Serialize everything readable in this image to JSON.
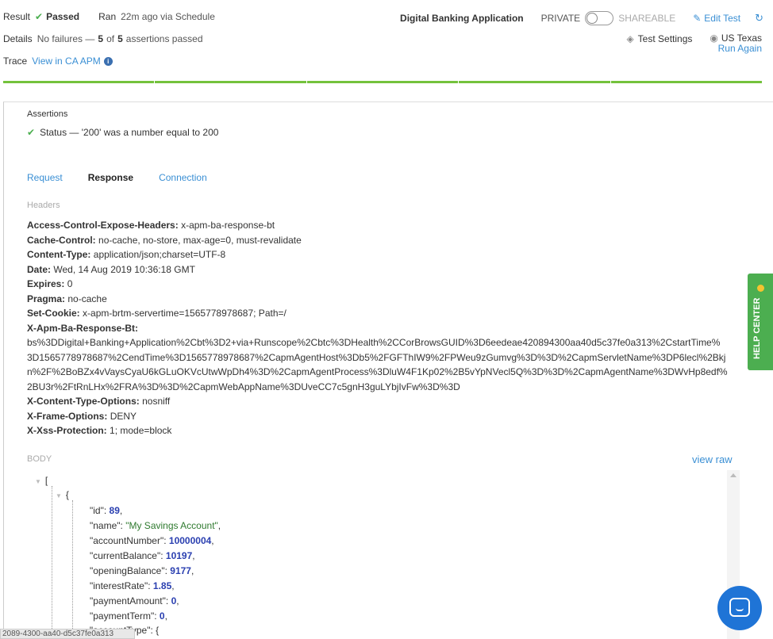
{
  "summary": {
    "result_label": "Result",
    "result_value": "Passed",
    "ran_label": "Ran",
    "ran_value": "22m ago via Schedule",
    "details_label": "Details",
    "details_prefix": "No failures —",
    "details_passed": "5",
    "details_of": "of",
    "details_total": "5",
    "details_suffix": "assertions passed",
    "trace_label": "Trace",
    "trace_link": "View in CA APM"
  },
  "header": {
    "app_name": "Digital Banking Application",
    "private_label": "PRIVATE",
    "shareable_label": "SHAREABLE",
    "edit_label": "Edit Test",
    "settings_label": "Test Settings",
    "location": "US Texas",
    "run_again": "Run Again"
  },
  "assertions": {
    "title": "Assertions",
    "items": [
      {
        "text": "Status — '200' was a number equal to 200"
      }
    ]
  },
  "tabs": [
    {
      "label": "Request"
    },
    {
      "label": "Response"
    },
    {
      "label": "Connection"
    }
  ],
  "headers_section": {
    "title": "Headers",
    "rows": [
      {
        "key": "Access-Control-Expose-Headers:",
        "value": "x-apm-ba-response-bt"
      },
      {
        "key": "Cache-Control:",
        "value": "no-cache, no-store, max-age=0, must-revalidate"
      },
      {
        "key": "Content-Type:",
        "value": "application/json;charset=UTF-8"
      },
      {
        "key": "Date:",
        "value": "Wed, 14 Aug 2019 10:36:18 GMT"
      },
      {
        "key": "Expires:",
        "value": "0"
      },
      {
        "key": "Pragma:",
        "value": "no-cache"
      },
      {
        "key": "Set-Cookie:",
        "value": "x-apm-brtm-servertime=1565778978687; Path=/"
      },
      {
        "key": "X-Apm-Ba-Response-Bt:",
        "value": ""
      },
      {
        "key": "X-Content-Type-Options:",
        "value": "nosniff"
      },
      {
        "key": "X-Frame-Options:",
        "value": "DENY"
      },
      {
        "key": "X-Xss-Protection:",
        "value": "1; mode=block"
      }
    ],
    "bt_value_lines": [
      "bs%3DDigital+Banking+Application%2Cbt%3D2+via+Runscope%2Cbtc%3DHealth%2CCorBrowsGUID%3D6eedeae420894300aa40d5c37fe0a313%2CstartTime%",
      "3D1565778978687%2CendTime%3D1565778978687%2CapmAgentHost%3Db5%2FGFThIW9%2FPWeu9zGumvg%3D%3D%2CapmServletName%3DP6lecl%2Bkj",
      "n%2F%2BoBZx4vVaysCyaU6kGLuOKVcUtwWpDh4%3D%2CapmAgentProcess%3DluW4F1Kp02%2B5vYpNVecl5Q%3D%3D%2CapmAgentName%3DWvHp8edf%",
      "2BU3r%2FtRnLHx%2FRA%3D%3D%2CapmWebAppName%3DUveCC7c5gnH3guLYbjIvFw%3D%3D"
    ]
  },
  "body_section": {
    "title": "BODY",
    "view_raw": "view raw",
    "json": {
      "open_array": "[",
      "open_object": "{",
      "fields": [
        {
          "key": "\"id\"",
          "value": "89",
          "kind": "num"
        },
        {
          "key": "\"name\"",
          "value": "\"My Savings Account\"",
          "kind": "str"
        },
        {
          "key": "\"accountNumber\"",
          "value": "10000004",
          "kind": "num"
        },
        {
          "key": "\"currentBalance\"",
          "value": "10197",
          "kind": "num"
        },
        {
          "key": "\"openingBalance\"",
          "value": "9177",
          "kind": "num"
        },
        {
          "key": "\"interestRate\"",
          "value": "1.85",
          "kind": "num"
        },
        {
          "key": "\"paymentAmount\"",
          "value": "0",
          "kind": "num"
        },
        {
          "key": "\"paymentTerm\"",
          "value": "0",
          "kind": "num"
        }
      ],
      "nested_key": "\"accountType\"",
      "nested_open": "{"
    }
  },
  "status_bar": {
    "text": "2089-4300-aa40-d5c37fe0a313"
  },
  "help_center": {
    "label": "HELP CENTER"
  },
  "colors": {
    "accent": "#3a8fd4",
    "success": "#74c23c",
    "number": "#2a3fb0",
    "string": "#2f7a2f",
    "help": "#4cae50",
    "chat": "#1f74d6"
  },
  "icons": [
    "check-icon",
    "info-icon",
    "pencil-icon",
    "refresh-icon",
    "layers-icon",
    "location-pin-icon",
    "caret-down-icon",
    "chat-icon"
  ]
}
